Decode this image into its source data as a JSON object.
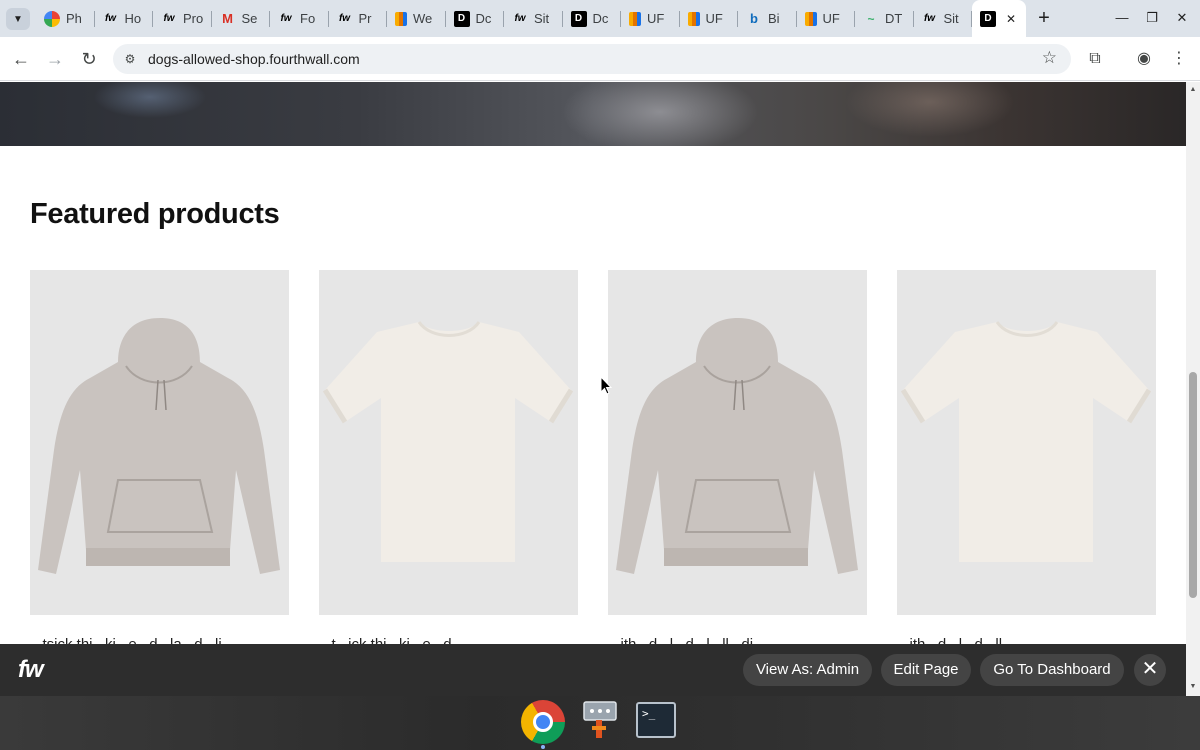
{
  "browser": {
    "tabs": [
      {
        "favicon": "photos-icon",
        "label": "Ph",
        "active": false
      },
      {
        "favicon": "fw",
        "label": "Ho",
        "active": false
      },
      {
        "favicon": "fw",
        "label": "Pro",
        "active": false
      },
      {
        "favicon": "gmail-icon",
        "label": "Se",
        "active": false
      },
      {
        "favicon": "fw",
        "label": "Fo",
        "active": false
      },
      {
        "favicon": "fw",
        "label": "Pr",
        "active": false
      },
      {
        "favicon": "analytics-icon",
        "label": "We",
        "active": false
      },
      {
        "favicon": "d",
        "label": "Dc",
        "active": false
      },
      {
        "favicon": "fw",
        "label": "Sit",
        "active": false
      },
      {
        "favicon": "d",
        "label": "Dc",
        "active": false
      },
      {
        "favicon": "analytics-icon",
        "label": "UF",
        "active": false
      },
      {
        "favicon": "analytics-icon",
        "label": "UF",
        "active": false
      },
      {
        "favicon": "bing-icon",
        "label": "Bi",
        "active": false
      },
      {
        "favicon": "analytics-icon",
        "label": "UF",
        "active": false
      },
      {
        "favicon": "dt-icon",
        "label": "DT",
        "active": false
      },
      {
        "favicon": "fw",
        "label": "Sit",
        "active": false
      },
      {
        "favicon": "d",
        "label": "",
        "active": true
      }
    ],
    "url": "dogs-allowed-shop.fourthwall.com"
  },
  "page": {
    "section_title": "Featured products",
    "products": [
      {
        "type": "hoodie",
        "title": "...tsick thi...ki...e...d...la...d...li..."
      },
      {
        "type": "tshirt",
        "title": "...t...ick thi...ki...e...d..."
      },
      {
        "type": "hoodie",
        "title": "...ith...d...l...d...l...ll...di..."
      },
      {
        "type": "tshirt",
        "title": "...ith...d...l...d...ll..."
      }
    ]
  },
  "admin_bar": {
    "logo": "fw",
    "view_as": "View As: Admin",
    "edit_page": "Edit Page",
    "dashboard": "Go To Dashboard"
  },
  "colors": {
    "tabstrip": "#dde3ea",
    "admin_bar": "#2d2d2d",
    "product_bg": "#e6e6e6",
    "hoodie": "#c9c3bf",
    "tshirt": "#f1ede7"
  }
}
